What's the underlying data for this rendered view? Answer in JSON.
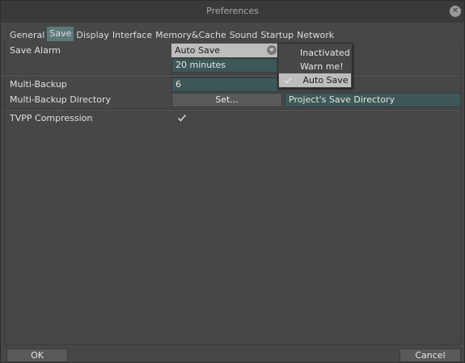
{
  "window": {
    "title": "Preferences",
    "close_icon": "close-icon"
  },
  "tabs": [
    {
      "label": "General",
      "active": false
    },
    {
      "label": "Save",
      "active": true
    },
    {
      "label": "Display",
      "active": false
    },
    {
      "label": "Interface",
      "active": false
    },
    {
      "label": "Memory&Cache",
      "active": false
    },
    {
      "label": "Sound",
      "active": false
    },
    {
      "label": "Startup",
      "active": false
    },
    {
      "label": "Network",
      "active": false
    }
  ],
  "save": {
    "save_alarm_label": "Save Alarm",
    "save_alarm_value": "Auto Save",
    "save_alarm_interval": "20 minutes",
    "multi_backup_label": "Multi-Backup",
    "multi_backup_value": "6",
    "multi_backup_dir_label": "Multi-Backup Directory",
    "set_button_label": "Set...",
    "multi_backup_dir_value": "Project's Save Directory",
    "tvpp_label": "TVPP Compression",
    "tvpp_checked": true
  },
  "dropdown": {
    "options": [
      "Inactivated",
      "Warn me!",
      "Auto Save"
    ],
    "selected": "Auto Save"
  },
  "footer": {
    "ok_label": "OK",
    "cancel_label": "Cancel"
  },
  "colors": {
    "accent": "#5e7878",
    "field_bg": "#3e5757",
    "window_bg": "#474747"
  }
}
